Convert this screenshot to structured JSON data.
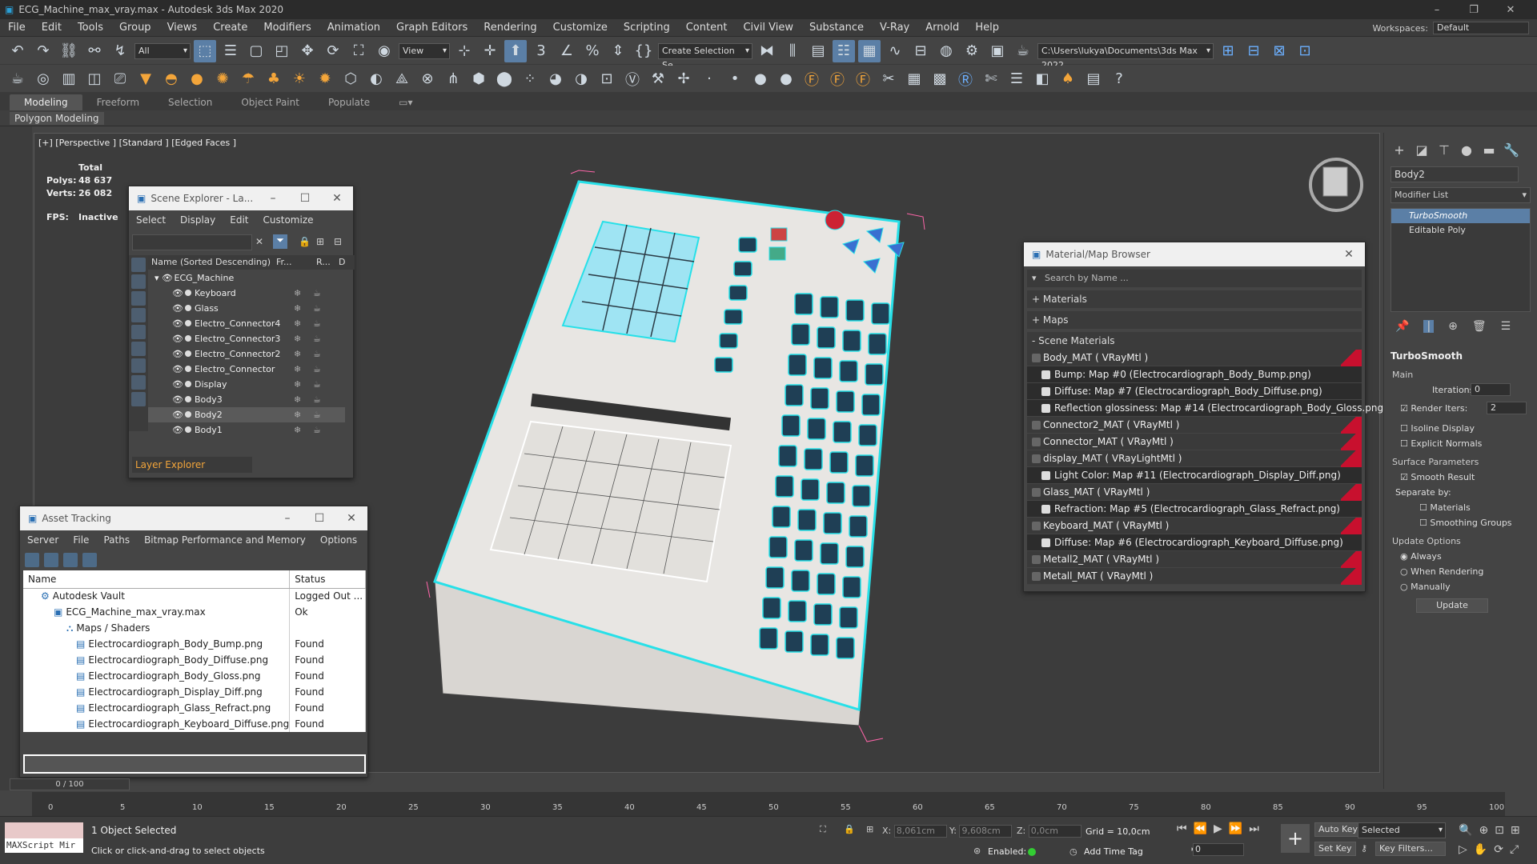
{
  "window": {
    "title": "ECG_Machine_max_vray.max - Autodesk 3ds Max 2020"
  },
  "menu": [
    "File",
    "Edit",
    "Tools",
    "Group",
    "Views",
    "Create",
    "Modifiers",
    "Animation",
    "Graph Editors",
    "Rendering",
    "Customize",
    "Scripting",
    "Content",
    "Civil View",
    "Substance",
    "V-Ray",
    "Arnold",
    "Help"
  ],
  "workspace": {
    "label": "Workspaces:",
    "value": "Default"
  },
  "toolbar": {
    "filter": "All",
    "view": "View",
    "selection_set": "Create Selection Se",
    "path": "C:\\Users\\lukya\\Documents\\3ds Max 2022"
  },
  "ribbon": {
    "tabs": [
      "Modeling",
      "Freeform",
      "Selection",
      "Object Paint",
      "Populate"
    ],
    "sub": "Polygon Modeling"
  },
  "viewport": {
    "label": "[+] [Perspective ] [Standard ] [Edged Faces ]",
    "stats": {
      "total": "Total",
      "polys_label": "Polys:",
      "polys": "48 637",
      "verts_label": "Verts:",
      "verts": "26 082",
      "fps_label": "FPS:",
      "fps": "Inactive"
    }
  },
  "scene_explorer": {
    "title": "Scene Explorer - La...",
    "menu": [
      "Select",
      "Display",
      "Edit",
      "Customize"
    ],
    "column_name": "Name (Sorted Descending)",
    "col_fr": "Fr...",
    "col_r": "R...",
    "col_d": "D",
    "root": "ECG_Machine",
    "items": [
      "Keyboard",
      "Glass",
      "Electro_Connector4",
      "Electro_Connector3",
      "Electro_Connector2",
      "Electro_Connector",
      "Display",
      "Body3",
      "Body2",
      "Body1"
    ],
    "layer_explorer": "Layer Explorer"
  },
  "asset_tracking": {
    "title": "Asset Tracking",
    "menu": [
      "Server",
      "File",
      "Paths",
      "Bitmap Performance and Memory",
      "Options"
    ],
    "col_name": "Name",
    "col_status": "Status",
    "rows": [
      {
        "name": "Autodesk Vault",
        "status": "Logged Out ..."
      },
      {
        "name": "ECG_Machine_max_vray.max",
        "status": "Ok"
      },
      {
        "name": "Maps / Shaders",
        "status": ""
      },
      {
        "name": "Electrocardiograph_Body_Bump.png",
        "status": "Found"
      },
      {
        "name": "Electrocardiograph_Body_Diffuse.png",
        "status": "Found"
      },
      {
        "name": "Electrocardiograph_Body_Gloss.png",
        "status": "Found"
      },
      {
        "name": "Electrocardiograph_Display_Diff.png",
        "status": "Found"
      },
      {
        "name": "Electrocardiograph_Glass_Refract.png",
        "status": "Found"
      },
      {
        "name": "Electrocardiograph_Keyboard_Diffuse.png",
        "status": "Found"
      }
    ]
  },
  "material_browser": {
    "title": "Material/Map Browser",
    "search_placeholder": "Search by Name ...",
    "sections": [
      "+ Materials",
      "+ Maps",
      "- Scene Materials"
    ],
    "rows": [
      {
        "text": "Body_MAT  ( VRayMtl )",
        "sub": false
      },
      {
        "text": "Bump: Map #0 (Electrocardiograph_Body_Bump.png)",
        "sub": true
      },
      {
        "text": "Diffuse: Map #7 (Electrocardiograph_Body_Diffuse.png)",
        "sub": true
      },
      {
        "text": "Reflection glossiness: Map #14 (Electrocardiograph_Body_Gloss.png)",
        "sub": true
      },
      {
        "text": "Connector2_MAT  ( VRayMtl )",
        "sub": false
      },
      {
        "text": "Connector_MAT  ( VRayMtl )",
        "sub": false
      },
      {
        "text": "display_MAT  ( VRayLightMtl )",
        "sub": false
      },
      {
        "text": "Light Color: Map #11 (Electrocardiograph_Display_Diff.png)",
        "sub": true
      },
      {
        "text": "Glass_MAT  ( VRayMtl )",
        "sub": false
      },
      {
        "text": "Refraction: Map #5 (Electrocardiograph_Glass_Refract.png)",
        "sub": true
      },
      {
        "text": "Keyboard_MAT  ( VRayMtl )",
        "sub": false
      },
      {
        "text": "Diffuse: Map #6 (Electrocardiograph_Keyboard_Diffuse.png)",
        "sub": true
      },
      {
        "text": "Metall2_MAT  ( VRayMtl )",
        "sub": false
      },
      {
        "text": "Metall_MAT  ( VRayMtl )",
        "sub": false
      }
    ]
  },
  "command_panel": {
    "object_name": "Body2",
    "modifier_list": "Modifier List",
    "stack": [
      "TurboSmooth",
      "Editable Poly"
    ],
    "rollout": "TurboSmooth",
    "main": "Main",
    "iterations_label": "Iterations:",
    "iterations": "0",
    "render_iters_label": "Render Iters:",
    "render_iters": "2",
    "isoline": "Isoline Display",
    "explicit": "Explicit Normals",
    "surface": "Surface Parameters",
    "smooth_result": "Smooth Result",
    "separate": "Separate by:",
    "materials": "Materials",
    "smoothing_groups": "Smoothing Groups",
    "update_options": "Update Options",
    "always": "Always",
    "when_rendering": "When Rendering",
    "manually": "Manually",
    "update_btn": "Update"
  },
  "timeline": {
    "frame": "0 / 100",
    "ticks": [
      "0",
      "5",
      "10",
      "15",
      "20",
      "25",
      "30",
      "35",
      "40",
      "45",
      "50",
      "55",
      "60",
      "65",
      "70",
      "75",
      "80",
      "85",
      "90",
      "95",
      "100"
    ]
  },
  "status": {
    "selected": "1 Object Selected",
    "hint": "Click or click-and-drag to select objects",
    "maxscript": "MAXScript Mir",
    "x_label": "X:",
    "x": "8,061cm",
    "y_label": "Y:",
    "y": "9,608cm",
    "z_label": "Z:",
    "z": "0,0cm",
    "grid": "Grid = 10,0cm",
    "enabled": "Enabled:",
    "add_time_tag": "Add Time Tag",
    "auto_key": "Auto Key",
    "set_key": "Set Key",
    "selected_dd": "Selected",
    "key_filters": "Key Filters...",
    "frame_field": "0"
  }
}
